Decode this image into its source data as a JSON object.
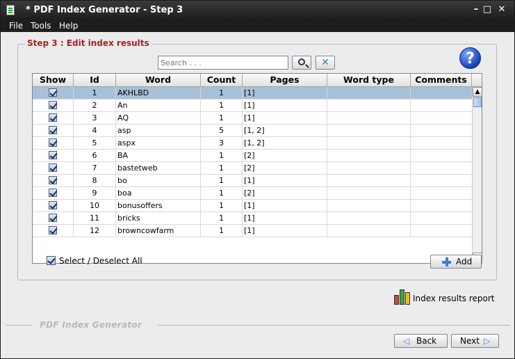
{
  "window": {
    "title": "* PDF Index Generator - Step 3"
  },
  "menu": {
    "file": "File",
    "tools": "Tools",
    "help": "Help"
  },
  "step": {
    "title": "Step 3 : Edit index results"
  },
  "search": {
    "placeholder": "Search . . ."
  },
  "table": {
    "columns": [
      "Show",
      "Id",
      "Word",
      "Count",
      "Pages",
      "Word type",
      "Comments"
    ],
    "rows": [
      {
        "id": "1",
        "word": "AKHLBD",
        "count": "1",
        "pages": "[1]"
      },
      {
        "id": "2",
        "word": "An",
        "count": "1",
        "pages": "[1]"
      },
      {
        "id": "3",
        "word": "AQ",
        "count": "1",
        "pages": "[1]"
      },
      {
        "id": "4",
        "word": "asp",
        "count": "5",
        "pages": "[1, 2]"
      },
      {
        "id": "5",
        "word": "aspx",
        "count": "3",
        "pages": "[1, 2]"
      },
      {
        "id": "6",
        "word": "BA",
        "count": "1",
        "pages": "[2]"
      },
      {
        "id": "7",
        "word": "bastetweb",
        "count": "1",
        "pages": "[2]"
      },
      {
        "id": "8",
        "word": "bo",
        "count": "1",
        "pages": "[1]"
      },
      {
        "id": "9",
        "word": "boa",
        "count": "1",
        "pages": "[2]"
      },
      {
        "id": "10",
        "word": "bonusoffers",
        "count": "1",
        "pages": "[1]"
      },
      {
        "id": "11",
        "word": "bricks",
        "count": "1",
        "pages": "[1]"
      },
      {
        "id": "12",
        "word": "browncowfarm",
        "count": "1",
        "pages": "[1]"
      }
    ]
  },
  "select_all": {
    "label": "Select / Deselect All"
  },
  "buttons": {
    "add": "Add",
    "back": "Back",
    "next": "Next"
  },
  "report": {
    "label": "Index results report"
  },
  "footer": {
    "brand": "PDF Index Generator"
  },
  "colors": {
    "step_title": "#b02020",
    "selected_row": "#a7c1d8"
  },
  "icons": [
    "app-icon",
    "search-icon",
    "clear-icon",
    "help-icon",
    "plus-icon",
    "report-icon"
  ]
}
